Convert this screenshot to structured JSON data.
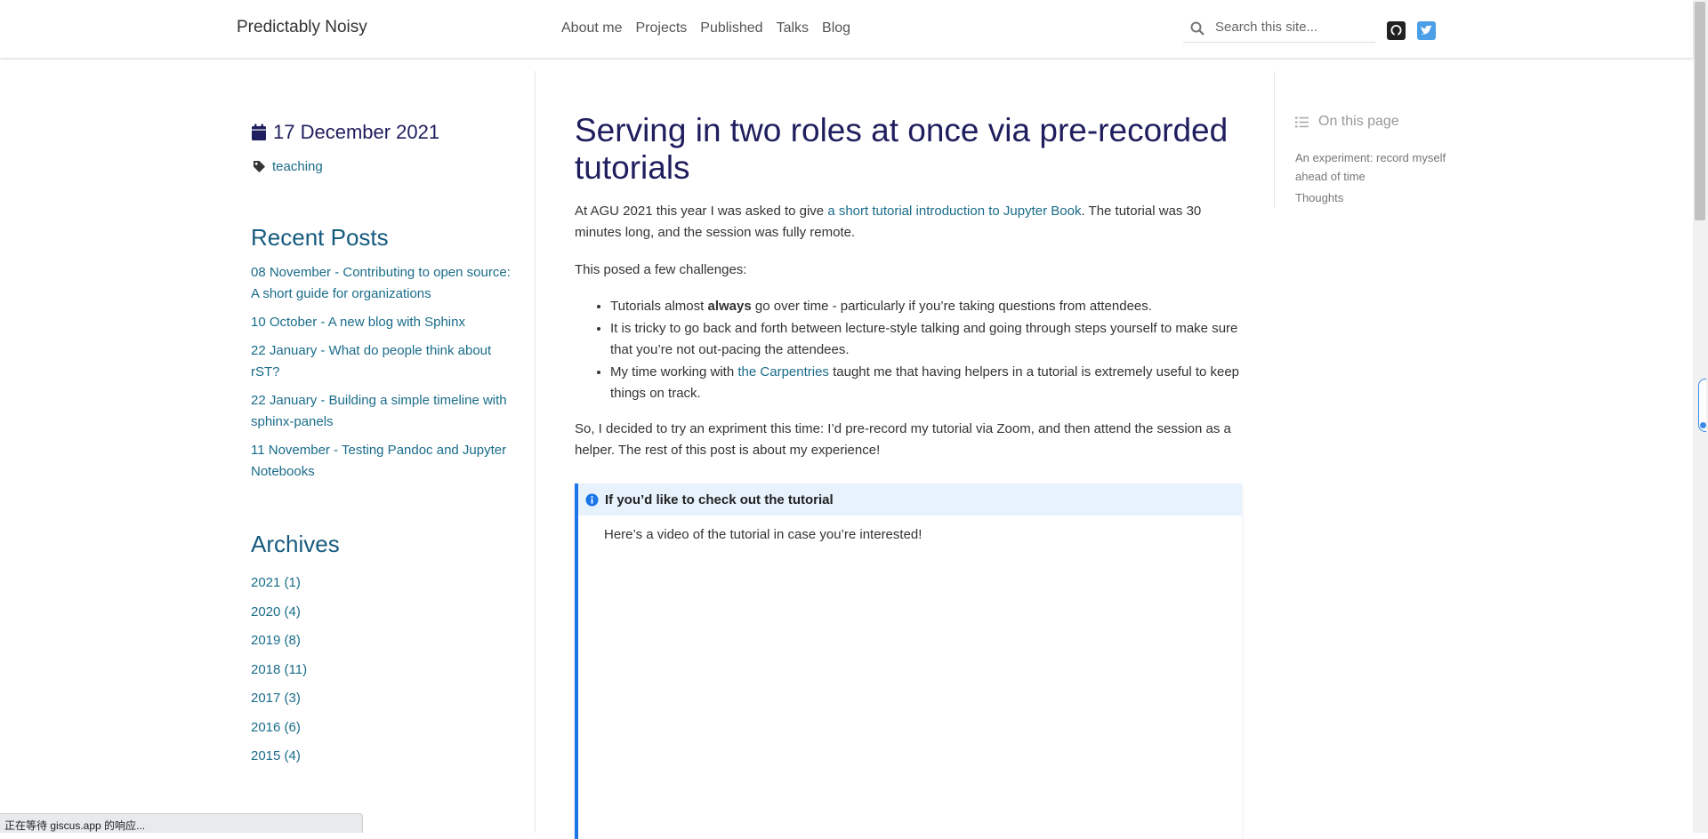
{
  "brand": "Predictably Noisy",
  "nav": {
    "links": [
      "About me",
      "Projects",
      "Published",
      "Talks",
      "Blog"
    ]
  },
  "search": {
    "placeholder": "Search this site..."
  },
  "icons": {
    "search": "search-icon",
    "github": "github-icon",
    "twitter": "twitter-icon",
    "calendar": "calendar-icon",
    "tag": "tag-icon",
    "info": "info-icon",
    "list": "list-icon"
  },
  "colors": {
    "accent": "#1a75e8",
    "title": "#1f1e5e",
    "link": "#1a6c8a",
    "twitter": "#4a9fe6"
  },
  "post": {
    "date": "17 December 2021",
    "tag": "teaching",
    "title": "Serving in two roles at once via pre-recorded tutorials",
    "intro_before": "At AGU 2021 this year I was asked to give ",
    "intro_link": "a short tutorial introduction to Jupyter Book",
    "intro_after": ". The tutorial was 30 minutes long, and the session was fully remote.",
    "challenges": "This posed a few challenges:",
    "bullet1_before": "Tutorials almost ",
    "bullet1_bold": "always",
    "bullet1_after": " go over time - particularly if you’re taking questions from attendees.",
    "bullet2": "It is tricky to go back and forth between lecture-style talking and going through steps yourself to make sure that you’re not out-pacing the attendees.",
    "bullet3_before": "My time working with ",
    "bullet3_link": "the Carpentries",
    "bullet3_after": " taught me that having helpers in a tutorial is extremely useful to keep things on track.",
    "decision": "So, I decided to try an expriment this time: I’d pre-record my tutorial via Zoom, and then attend the session as a helper. The rest of this post is about my experience!",
    "admonition": {
      "title": "If you’d like to check out the tutorial",
      "body": "Here’s a video of the tutorial in case you’re interested!"
    }
  },
  "sidebar": {
    "recent_title": "Recent Posts",
    "recent": [
      "08 November - Contributing to open source: A short guide for organizations",
      "10 October - A new blog with Sphinx",
      "22 January - What do people think about rST?",
      "22 January - Building a simple timeline with sphinx-panels",
      "11 November - Testing Pandoc and Jupyter Notebooks"
    ],
    "archives_title": "Archives",
    "archives": [
      "2021 (1)",
      "2020 (4)",
      "2019 (8)",
      "2018 (11)",
      "2017 (3)",
      "2016 (6)",
      "2015 (4)"
    ]
  },
  "toc": {
    "title": "On this page",
    "items": [
      "An experiment: record myself ahead of time",
      "Thoughts"
    ]
  },
  "status": "正在等待 giscus.app 的响应..."
}
